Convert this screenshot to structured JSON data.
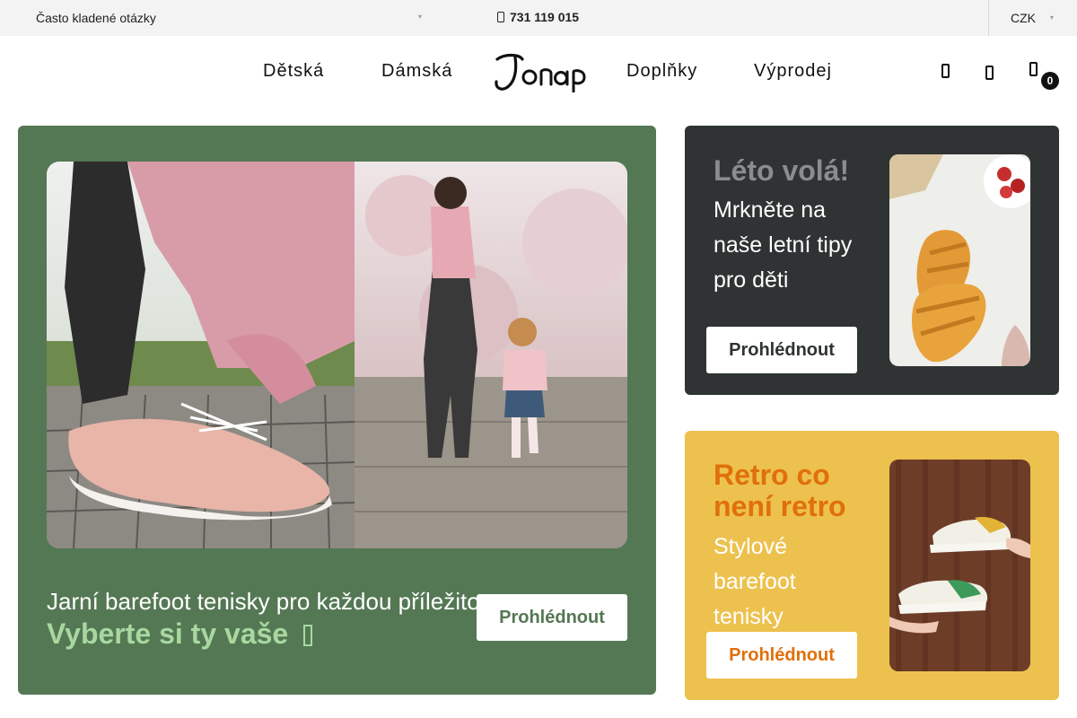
{
  "topbar": {
    "faq_label": "Často kladené otázky",
    "phone": "731 119 015",
    "currency": "CZK"
  },
  "nav": {
    "items": [
      {
        "label": "Dětská"
      },
      {
        "label": "Dámská"
      },
      {
        "label": "Doplňky"
      },
      {
        "label": "Výprodej"
      }
    ],
    "logo_text": "Jonap",
    "cart_count": "0",
    "icons": [
      "search-icon",
      "user-icon",
      "cart-icon"
    ]
  },
  "hero": {
    "subtitle": "Jarní barefoot tenisky pro každou příležitost",
    "cta_text": "Vyberte si ty vaše",
    "button_label": "Prohlédnout",
    "bg_color": "#547854",
    "cta_color": "#a8d8a0"
  },
  "promos": [
    {
      "title": "Léto volá!",
      "description": "Mrkněte na naše letní tipy pro děti",
      "button_label": "Prohlédnout",
      "bg_color": "#2f3333"
    },
    {
      "title": "Retro co není retro",
      "description": "Stylové barefoot tenisky",
      "button_label": "Prohlédnout",
      "bg_color": "#edc14e",
      "accent_color": "#e0700a"
    }
  ]
}
